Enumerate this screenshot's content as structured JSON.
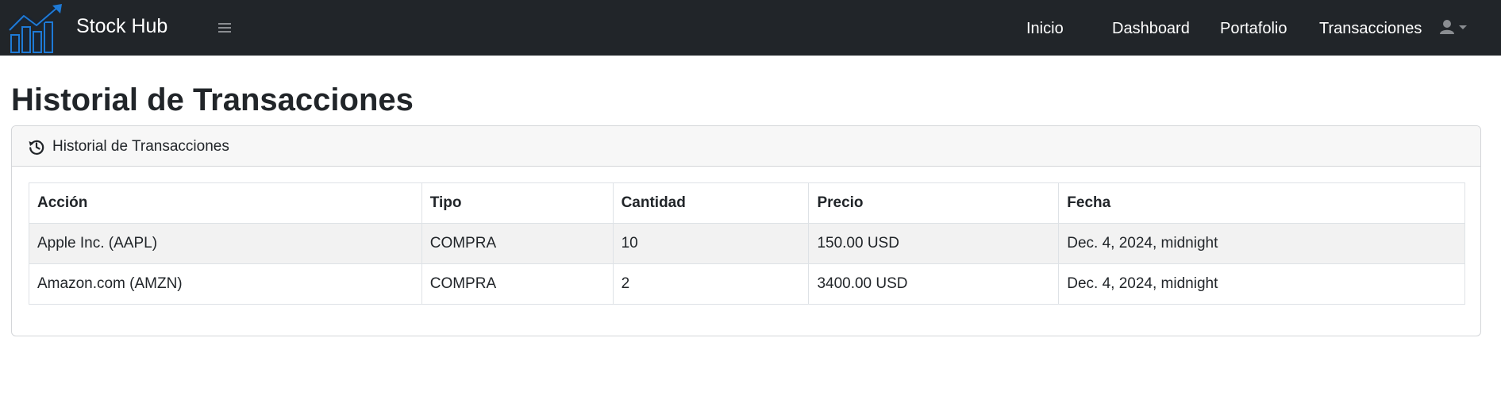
{
  "app": {
    "brand_name": "Stock Hub"
  },
  "nav": {
    "items": [
      {
        "label": "Inicio"
      },
      {
        "label": "Dashboard"
      },
      {
        "label": "Portafolio"
      },
      {
        "label": "Transacciones"
      }
    ],
    "menu_icon": "hamburger-icon",
    "user_icon": "user-icon"
  },
  "page": {
    "title": "Historial de Transacciones"
  },
  "card": {
    "header_icon": "history-icon",
    "header_title": "Historial de Transacciones"
  },
  "table": {
    "columns": [
      "Acción",
      "Tipo",
      "Cantidad",
      "Precio",
      "Fecha"
    ],
    "rows": [
      {
        "accion": "Apple Inc. (AAPL)",
        "tipo": "COMPRA",
        "cantidad": "10",
        "precio": "150.00 USD",
        "fecha": "Dec. 4, 2024, midnight"
      },
      {
        "accion": "Amazon.com (AMZN)",
        "tipo": "COMPRA",
        "cantidad": "2",
        "precio": "3400.00 USD",
        "fecha": "Dec. 4, 2024, midnight"
      }
    ]
  },
  "colors": {
    "navbar_bg": "#212529",
    "logo_accent": "#1e7ad6",
    "striped_row": "#f2f2f2"
  }
}
